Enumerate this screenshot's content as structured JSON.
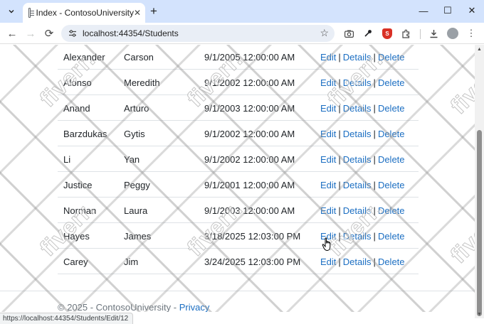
{
  "browser": {
    "tab": {
      "title": "Index - ContosoUniversity",
      "favicon": "page-icon"
    },
    "tab_menu_icon": "chevron-down-icon",
    "new_tab_icon": "plus-icon",
    "window_controls": {
      "minimize": "—",
      "maximize": "☐",
      "close": "✕"
    },
    "nav": {
      "back": "←",
      "forward": "→",
      "reload": "⟳"
    },
    "address": {
      "url": "localhost:44354/Students",
      "site_info_icon": "tune-icon",
      "bookmark_icon": "star-icon"
    },
    "extensions": [
      "camera-icon",
      "eyedropper-icon",
      "shield-extension-icon",
      "puzzle-icon",
      "download-icon",
      "profile-avatar-icon",
      "more-vert-icon"
    ]
  },
  "students": {
    "rows": [
      {
        "last": "Alexander",
        "first": "Carson",
        "date": "9/1/2005 12:00:00 AM"
      },
      {
        "last": "Alonso",
        "first": "Meredith",
        "date": "9/1/2002 12:00:00 AM"
      },
      {
        "last": "Anand",
        "first": "Arturo",
        "date": "9/1/2003 12:00:00 AM"
      },
      {
        "last": "Barzdukas",
        "first": "Gytis",
        "date": "9/1/2002 12:00:00 AM"
      },
      {
        "last": "Li",
        "first": "Yan",
        "date": "9/1/2002 12:00:00 AM"
      },
      {
        "last": "Justice",
        "first": "Peggy",
        "date": "9/1/2001 12:00:00 AM"
      },
      {
        "last": "Norman",
        "first": "Laura",
        "date": "9/1/2003 12:00:00 AM"
      },
      {
        "last": "Hayes",
        "first": "James",
        "date": "3/18/2025 12:03:00 PM"
      },
      {
        "last": "Carey",
        "first": "Jim",
        "date": "3/24/2025 12:03:00 PM"
      }
    ],
    "actions": {
      "edit": "Edit",
      "details": "Details",
      "delete": "Delete",
      "separator": "|"
    }
  },
  "footer": {
    "copyright": "© 2025 - ContosoUniversity -",
    "privacy": "Privacy"
  },
  "status_url": "https://localhost:44354/Students/Edit/12",
  "watermark": {
    "text": "fiverr."
  },
  "colors": {
    "link": "#1b6ec2",
    "tabstrip": "#d3e3fd",
    "omnibox": "#e9eef6"
  }
}
